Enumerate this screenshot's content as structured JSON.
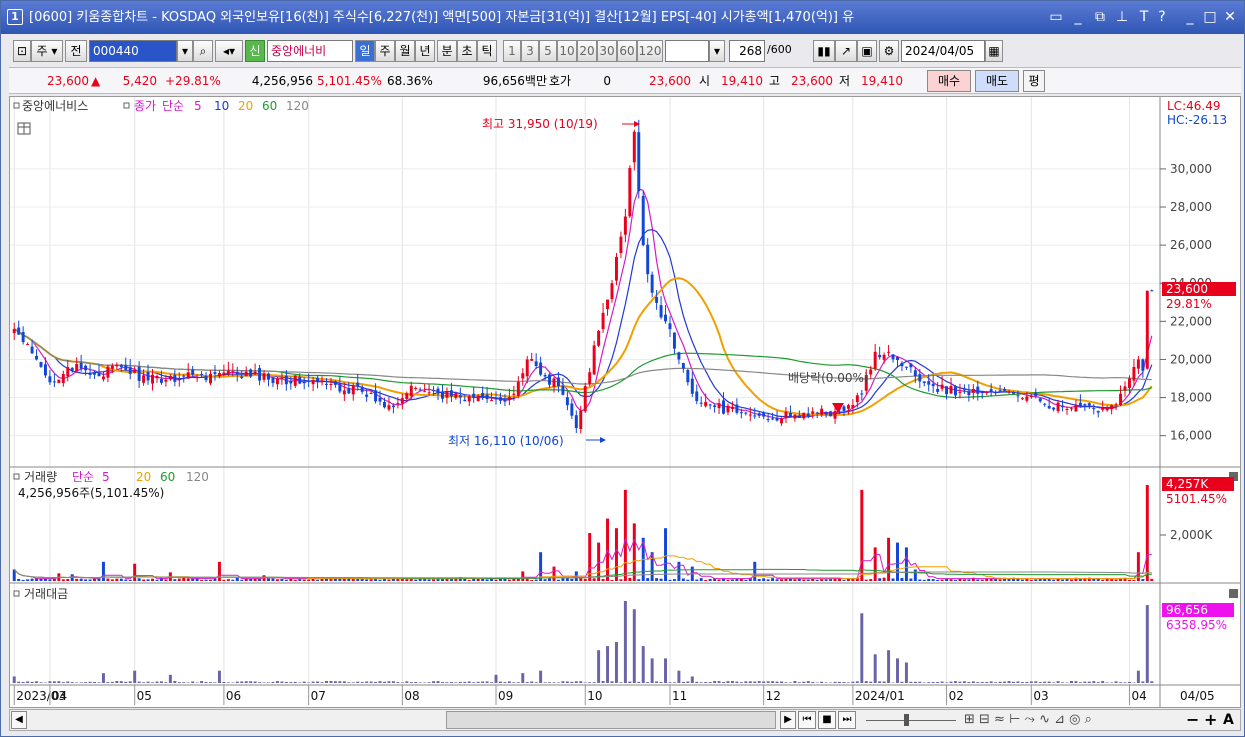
{
  "window": {
    "number": "1",
    "title": "[0600] 키움종합차트 - KOSDAQ 외국인보유[16(천)] 주식수[6,227(천)] 액면[500] 자본금[31(억)] 결산[12월] EPS[-40] 시가총액[1,470(억)] 유"
  },
  "toolbar": {
    "market_label": "주",
    "prev_label": "전",
    "code": "000440",
    "new_badge": "신",
    "stock_name": "중앙에너비",
    "periods": [
      "일",
      "주",
      "월",
      "년",
      "분",
      "초",
      "틱"
    ],
    "intervals": [
      "1",
      "3",
      "5",
      "10",
      "20",
      "30",
      "60",
      "120"
    ],
    "count": "268",
    "count_total": "/600",
    "date": "2024/04/05"
  },
  "quote": {
    "price": "23,600",
    "change": "5,420",
    "change_pct": "+29.81%",
    "volume": "4,256,956",
    "volume_ratio": "5,101.45%",
    "turnover_ratio": "68.36%",
    "amount": "96,656백만",
    "hoga_label": "호가",
    "hoga_value": "0",
    "current": "23,600",
    "open_label": "시",
    "open": "19,410",
    "high_label": "고",
    "high": "23,600",
    "low_label": "저",
    "low": "19,410",
    "buy_label": "매수",
    "sell_label": "매도",
    "eval_label": "평"
  },
  "colors": {
    "up": "#e8001c",
    "down": "#1146d6",
    "ma5": "#d21cc8",
    "ma10": "#2238d8",
    "ma20": "#f0a000",
    "ma60": "#1e9a30",
    "ma120": "#888888",
    "amount_bar": "#6a63a8",
    "badge_pink": "#ee11ee"
  },
  "chart_data": [
    {
      "type": "candlestick",
      "panel": "price",
      "title": "중앙에너비스",
      "legend": [
        {
          "name": "종가",
          "color": "#d21cc8"
        },
        {
          "name": "단순",
          "color": "#d21cc8"
        },
        {
          "name": "5",
          "color": "#d21cc8"
        },
        {
          "name": "10",
          "color": "#2238d8"
        },
        {
          "name": "20",
          "color": "#f0a000"
        },
        {
          "name": "60",
          "color": "#1e9a30"
        },
        {
          "name": "120",
          "color": "#888888"
        }
      ],
      "ylim": [
        15300,
        32200
      ],
      "yticks": [
        16000,
        18000,
        20000,
        22000,
        24000,
        26000,
        28000,
        30000
      ],
      "ytick_labels": [
        "16,000",
        "18,000",
        "20,000",
        "22,000",
        "24,000",
        "26,000",
        "28,000",
        "30,000"
      ],
      "x_tick_labels": [
        "2023/03",
        "04",
        "05",
        "06",
        "07",
        "08",
        "09",
        "10",
        "11",
        "12",
        "2024/01",
        "02",
        "03",
        "04"
      ],
      "x_tick_index": [
        0,
        8,
        27,
        47,
        66,
        87,
        108,
        128,
        147,
        168,
        188,
        209,
        228,
        250
      ],
      "right_end_label": "04/05",
      "corner_labels": {
        "lc": "LC:46.49",
        "hc": "HC:-26.13"
      },
      "annotations": {
        "high": "최고 31,950 (10/19)",
        "low": "최저 16,110 (10/06)",
        "event": "배당락(0.00%)"
      },
      "last_price_label": "23,600",
      "last_change_label": "29.81%",
      "price_path": [
        [
          0,
          21600
        ],
        [
          8,
          18800
        ],
        [
          12,
          19600
        ],
        [
          18,
          19200
        ],
        [
          24,
          19600
        ],
        [
          30,
          18900
        ],
        [
          40,
          19200
        ],
        [
          50,
          19200
        ],
        [
          60,
          19000
        ],
        [
          70,
          18700
        ],
        [
          78,
          18300
        ],
        [
          84,
          17600
        ],
        [
          90,
          18500
        ],
        [
          100,
          18000
        ],
        [
          108,
          17900
        ],
        [
          112,
          18200
        ],
        [
          115,
          20000
        ],
        [
          118,
          19200
        ],
        [
          122,
          18600
        ],
        [
          124,
          17600
        ],
        [
          126,
          16400
        ],
        [
          128,
          18600
        ],
        [
          131,
          21500
        ],
        [
          134,
          24000
        ],
        [
          137,
          27500
        ],
        [
          139,
          31950
        ],
        [
          141,
          26000
        ],
        [
          143,
          23500
        ],
        [
          146,
          22000
        ],
        [
          149,
          20000
        ],
        [
          152,
          18200
        ],
        [
          156,
          17600
        ],
        [
          162,
          17200
        ],
        [
          168,
          17000
        ],
        [
          174,
          17000
        ],
        [
          180,
          17200
        ],
        [
          186,
          17300
        ],
        [
          190,
          18200
        ],
        [
          193,
          20400
        ],
        [
          196,
          20400
        ],
        [
          200,
          19600
        ],
        [
          206,
          18600
        ],
        [
          212,
          18300
        ],
        [
          218,
          18300
        ],
        [
          224,
          18200
        ],
        [
          230,
          17800
        ],
        [
          236,
          17400
        ],
        [
          242,
          17400
        ],
        [
          246,
          17600
        ],
        [
          248,
          18200
        ],
        [
          250,
          19000
        ],
        [
          252,
          20000
        ],
        [
          253,
          19410
        ],
        [
          254,
          23600
        ]
      ],
      "volume_spikes": [
        [
          0,
          0.12
        ],
        [
          10,
          0.08
        ],
        [
          13,
          0.07
        ],
        [
          20,
          0.2
        ],
        [
          27,
          0.18
        ],
        [
          35,
          0.09
        ],
        [
          46,
          0.2
        ],
        [
          56,
          0.06
        ],
        [
          100,
          0.04
        ],
        [
          114,
          0.1
        ],
        [
          118,
          0.3
        ],
        [
          121,
          0.15
        ],
        [
          126,
          0.1
        ],
        [
          129,
          0.5
        ],
        [
          131,
          0.4
        ],
        [
          133,
          0.65
        ],
        [
          135,
          0.55
        ],
        [
          137,
          0.95
        ],
        [
          139,
          0.6
        ],
        [
          141,
          0.45
        ],
        [
          143,
          0.3
        ],
        [
          146,
          0.55
        ],
        [
          149,
          0.2
        ],
        [
          152,
          0.15
        ],
        [
          166,
          0.2
        ],
        [
          190,
          0.95
        ],
        [
          193,
          0.35
        ],
        [
          196,
          0.45
        ],
        [
          198,
          0.4
        ],
        [
          200,
          0.35
        ],
        [
          202,
          0.12
        ],
        [
          252,
          0.3
        ],
        [
          254,
          1.0
        ]
      ],
      "amount_spikes": [
        [
          0,
          0.08
        ],
        [
          20,
          0.12
        ],
        [
          27,
          0.15
        ],
        [
          35,
          0.1
        ],
        [
          46,
          0.15
        ],
        [
          108,
          0.1
        ],
        [
          114,
          0.12
        ],
        [
          118,
          0.15
        ],
        [
          131,
          0.4
        ],
        [
          133,
          0.45
        ],
        [
          135,
          0.5
        ],
        [
          137,
          1.0
        ],
        [
          139,
          0.9
        ],
        [
          141,
          0.45
        ],
        [
          143,
          0.3
        ],
        [
          146,
          0.3
        ],
        [
          149,
          0.15
        ],
        [
          152,
          0.08
        ],
        [
          190,
          0.85
        ],
        [
          193,
          0.35
        ],
        [
          196,
          0.4
        ],
        [
          198,
          0.3
        ],
        [
          200,
          0.25
        ],
        [
          252,
          0.15
        ],
        [
          254,
          0.95
        ]
      ]
    },
    {
      "type": "bar",
      "panel": "volume",
      "title": "거래량",
      "legend": [
        {
          "name": "단순",
          "color": "#d21cc8"
        },
        {
          "name": "5",
          "color": "#d21cc8"
        },
        {
          "name": "20",
          "color": "#f0a000"
        },
        {
          "name": "60",
          "color": "#1e9a30"
        },
        {
          "name": "120",
          "color": "#888888"
        }
      ],
      "info": "4,256,956주(5,101.45%)",
      "ytick_labels": [
        "2,000K"
      ],
      "last_label": "4,257K",
      "last_pct_label": "5101.45%"
    },
    {
      "type": "bar",
      "panel": "amount",
      "title": "거래대금",
      "last_label": "96,656",
      "last_pct_label": "6358.95%"
    }
  ]
}
